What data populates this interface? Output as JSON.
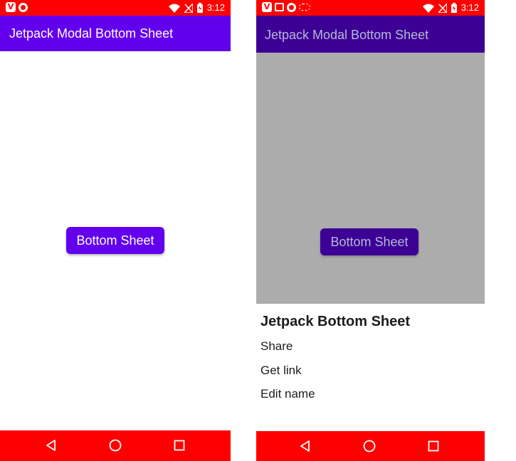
{
  "status_bar": {
    "time": "3:12",
    "color": "#ff0000"
  },
  "left": {
    "app_title": "Jetpack Modal Bottom Sheet",
    "button_label": "Bottom Sheet",
    "accent": "#6200ee"
  },
  "right": {
    "app_title": "Jetpack Modal Bottom Sheet",
    "button_label": "Bottom Sheet",
    "scrim_color": "#acacac",
    "sheet": {
      "title": "Jetpack Bottom Sheet",
      "items": [
        {
          "label": "Share"
        },
        {
          "label": "Get link"
        },
        {
          "label": "Edit name"
        }
      ]
    }
  },
  "nav": {
    "icons": [
      "back-icon",
      "home-icon",
      "recents-icon"
    ]
  }
}
